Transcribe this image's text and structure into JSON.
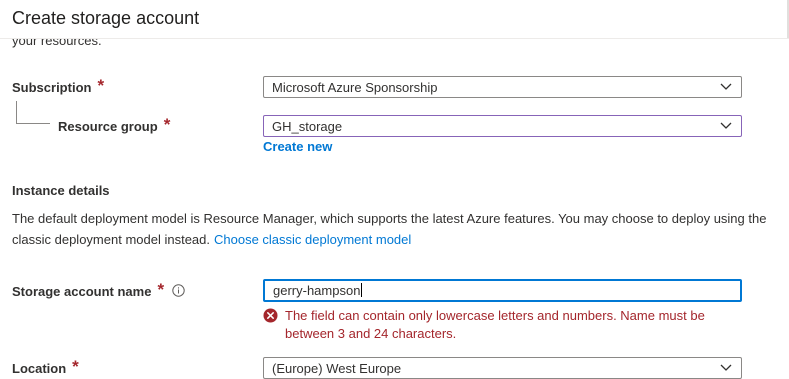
{
  "header": {
    "title": "Create storage account"
  },
  "intro": {
    "cutoff_text": "your resources."
  },
  "subscription": {
    "label": "Subscription",
    "required_mark": "*",
    "value": "Microsoft Azure Sponsorship"
  },
  "resource_group": {
    "label": "Resource group",
    "required_mark": "*",
    "value": "GH_storage",
    "create_new_link": "Create new"
  },
  "instance_details": {
    "title": "Instance details",
    "description": "The default deployment model is Resource Manager, which supports the latest Azure features. You may choose to deploy using the classic deployment model instead.",
    "classic_link": "Choose classic deployment model"
  },
  "storage_account_name": {
    "label": "Storage account name",
    "required_mark": "*",
    "value": "gerry-hampson",
    "error": "The field can contain only lowercase letters and numbers. Name must be between 3 and 24 characters."
  },
  "location": {
    "label": "Location",
    "required_mark": "*",
    "value": "(Europe) West Europe"
  },
  "icons": {
    "info": "info-circle-icon",
    "error": "error-circle-icon",
    "chevron": "chevron-down-icon"
  },
  "colors": {
    "accent": "#0078d4",
    "error": "#a4262c",
    "required": "#a4262c",
    "focus_border": "#8764b8"
  }
}
